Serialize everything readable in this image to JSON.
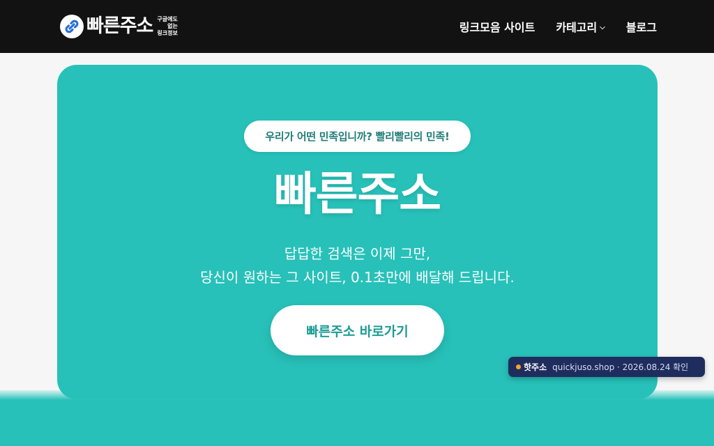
{
  "header": {
    "logo_text": "빠른주소",
    "logo_sub_lines": [
      "구글에도",
      "없는",
      "링크정보"
    ],
    "nav": [
      {
        "label": "링크모음 사이트"
      },
      {
        "label": "카테고리",
        "has_dropdown": true
      },
      {
        "label": "블로그"
      }
    ]
  },
  "hero": {
    "tagline": "우리가 어떤 민족입니까? 빨리빨리의 민족!",
    "title": "빠른주소",
    "desc_line1": "답답한 검색은 이제 그만,",
    "desc_line2": "당신이 원하는 그 사이트, 0.1초만에 배달해 드립니다.",
    "cta_label": "빠른주소 바로가기"
  },
  "toast": {
    "label": "핫주소",
    "info": "quickjuso.shop · 2026.08.24 확인"
  },
  "colors": {
    "header_bg": "#121212",
    "accent_teal": "#27c1b9",
    "toast_bg": "#1f2d5e",
    "toast_dot": "#f5a425"
  },
  "icons": [
    "chain-link-icon",
    "chevron-down-icon"
  ]
}
